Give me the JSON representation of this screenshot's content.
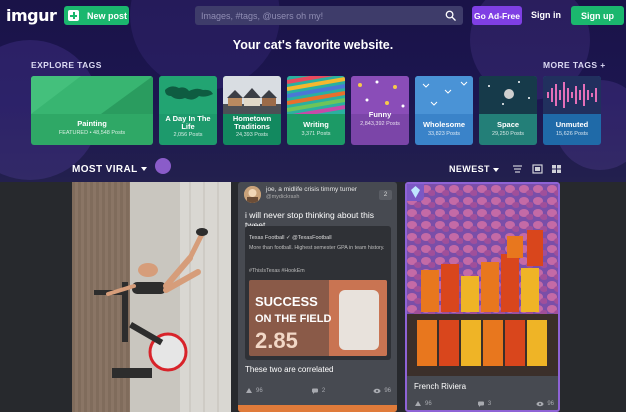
{
  "brand": {
    "logo_text": "imgur",
    "colors": {
      "green": "#1bb76e",
      "purple": "#7f3fe4",
      "hero_bg": "#1a1348",
      "page_bg": "#27292d"
    }
  },
  "header": {
    "new_post_label": "New post",
    "search_placeholder": "Images, #tags, @users oh my!",
    "ad_free_label": "Go Ad-Free",
    "sign_in_label": "Sign in",
    "sign_up_label": "Sign up"
  },
  "hero": {
    "tagline": "Your cat's favorite website.",
    "explore_label": "EXPLORE TAGS",
    "more_tags_label": "MORE TAGS +"
  },
  "tags": [
    {
      "name": "Painting",
      "subtitle": "FEATURED • 48,548 Posts",
      "color": "#2fa866"
    },
    {
      "name": "A Day In The Life",
      "subtitle": "2,056 Posts",
      "color": "#1d9a6c"
    },
    {
      "name": "Hometown Traditions",
      "subtitle": "24,393 Posts",
      "color": "#12895f"
    },
    {
      "name": "Writing",
      "subtitle": "3,371 Posts",
      "color": "#1c9a66"
    },
    {
      "name": "Funny",
      "subtitle": "2,843,392 Posts",
      "color": "#7b45a8"
    },
    {
      "name": "Wholesome",
      "subtitle": "33,823 Posts",
      "color": "#3a83c9"
    },
    {
      "name": "Space",
      "subtitle": "29,250 Posts",
      "color": "#237f78"
    },
    {
      "name": "Unmuted",
      "subtitle": "15,626 Posts",
      "color": "#1f6aa8"
    }
  ],
  "sort": {
    "section_label": "MOST VIRAL",
    "order_label": "NEWEST",
    "icons": [
      "sliders-icon",
      "card-view-icon",
      "grid-view-icon"
    ]
  },
  "posts": [
    {
      "id": "p1"
    },
    {
      "user_name": "joe, a midlife crisis timmy turner",
      "user_handle": "@mydickrash",
      "badge": "2",
      "title": "i will never stop thinking about this tweet",
      "tweet_user": "Texas Football ✓ @TexasFootball",
      "tweet_body": "More than football. Highest semester GPA in team history.",
      "tweet_hashtags": "#ThisIsTexas #HookEm",
      "tweet_image_text_1": "SUCCESS",
      "tweet_image_text_2": "ON THE FIELD",
      "tweet_image_text_3": "2.85",
      "caption": "These two are correlated",
      "stats": {
        "upvotes": "96",
        "comments": "2",
        "views": "96"
      }
    },
    {
      "caption": "French Riviera",
      "stats": {
        "upvotes": "96",
        "comments": "3",
        "views": "96"
      }
    }
  ]
}
